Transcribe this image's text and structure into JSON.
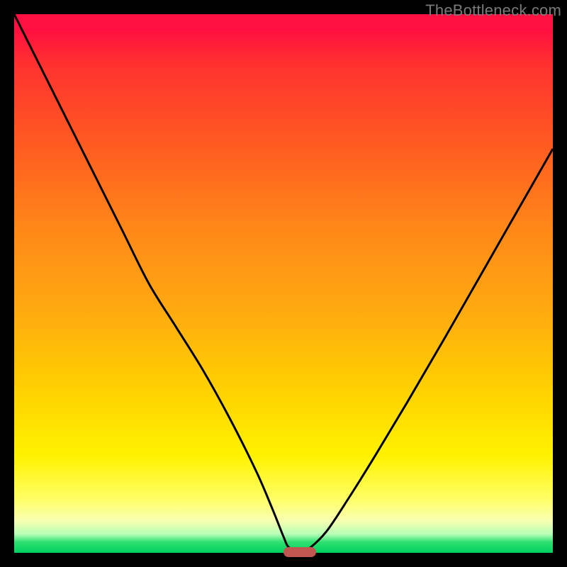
{
  "watermark": "TheBottleneck.com",
  "colors": {
    "curve_stroke": "#000000",
    "marker_fill": "#c1554f",
    "frame_bg": "#000000"
  },
  "chart_data": {
    "type": "line",
    "title": "",
    "xlabel": "",
    "ylabel": "",
    "xlim": [
      0,
      100
    ],
    "ylim": [
      0,
      100
    ],
    "legend": false,
    "grid": false,
    "background_gradient": "red-yellow-green vertical",
    "x": [
      0,
      2,
      5,
      10,
      15,
      20,
      25,
      30,
      35,
      40,
      45,
      48,
      50,
      51,
      53,
      55,
      58,
      62,
      67,
      73,
      80,
      88,
      96,
      100
    ],
    "values": [
      100,
      96,
      90,
      80,
      70,
      60,
      50,
      42,
      34,
      25,
      15,
      8,
      3,
      1,
      0,
      1,
      4,
      10,
      18,
      28,
      40,
      54,
      68,
      75
    ],
    "marker": {
      "x_center": 53,
      "width_pct": 6,
      "y": 0
    },
    "note": "Values estimated from pixel positions; axes have no tick labels in source image."
  }
}
